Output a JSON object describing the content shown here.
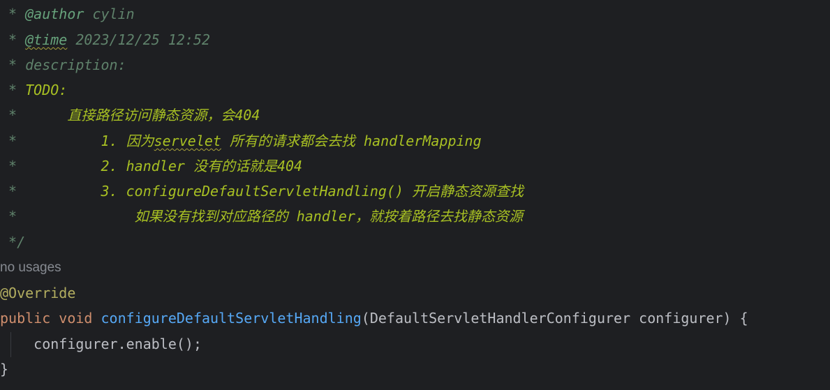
{
  "code": {
    "l1_star": " * ",
    "l1_tag": "@author",
    "l1_rest": " cylin",
    "l2_star": " * ",
    "l2_tag": "@time",
    "l2_rest": " 2023/12/25 12:52",
    "l3": " * description:",
    "l4_star": " * ",
    "l4_todo": "TODO:",
    "l5_star": " *",
    "l5_text": "      直接路径访问静态资源，会404",
    "l6_star": " *",
    "l6_pre": "          1. 因为",
    "l6_squig": "servelet",
    "l6_post": " 所有的请求都会去找 handlerMapping",
    "l7_star": " *",
    "l7_text": "          2. handler 没有的话就是404",
    "l8_star": " *",
    "l8_text": "          3. configureDefaultServletHandling() 开启静态资源查找",
    "l9_star": " *",
    "l9_text": "              如果没有找到对应路径的 handler，就按着路径去找静态资源",
    "l10": " */",
    "usages_hint": "no usages",
    "annotation": "@Override",
    "kw_public": "public",
    "kw_void": "void",
    "method_name": "configureDefaultServletHandling",
    "signature_rest": "(DefaultServletHandlerConfigurer configurer) {",
    "body_line": "    configurer.enable();",
    "close_brace": "}"
  },
  "colors": {
    "background": "#1e1f22",
    "doc_comment": "#5f826b",
    "doc_tag": "#67a37c",
    "todo": "#a8c023",
    "annotation": "#b3ae60",
    "keyword": "#cf8e6d",
    "method": "#56a8f5",
    "plain": "#bcbec4",
    "hint": "#868a91"
  }
}
